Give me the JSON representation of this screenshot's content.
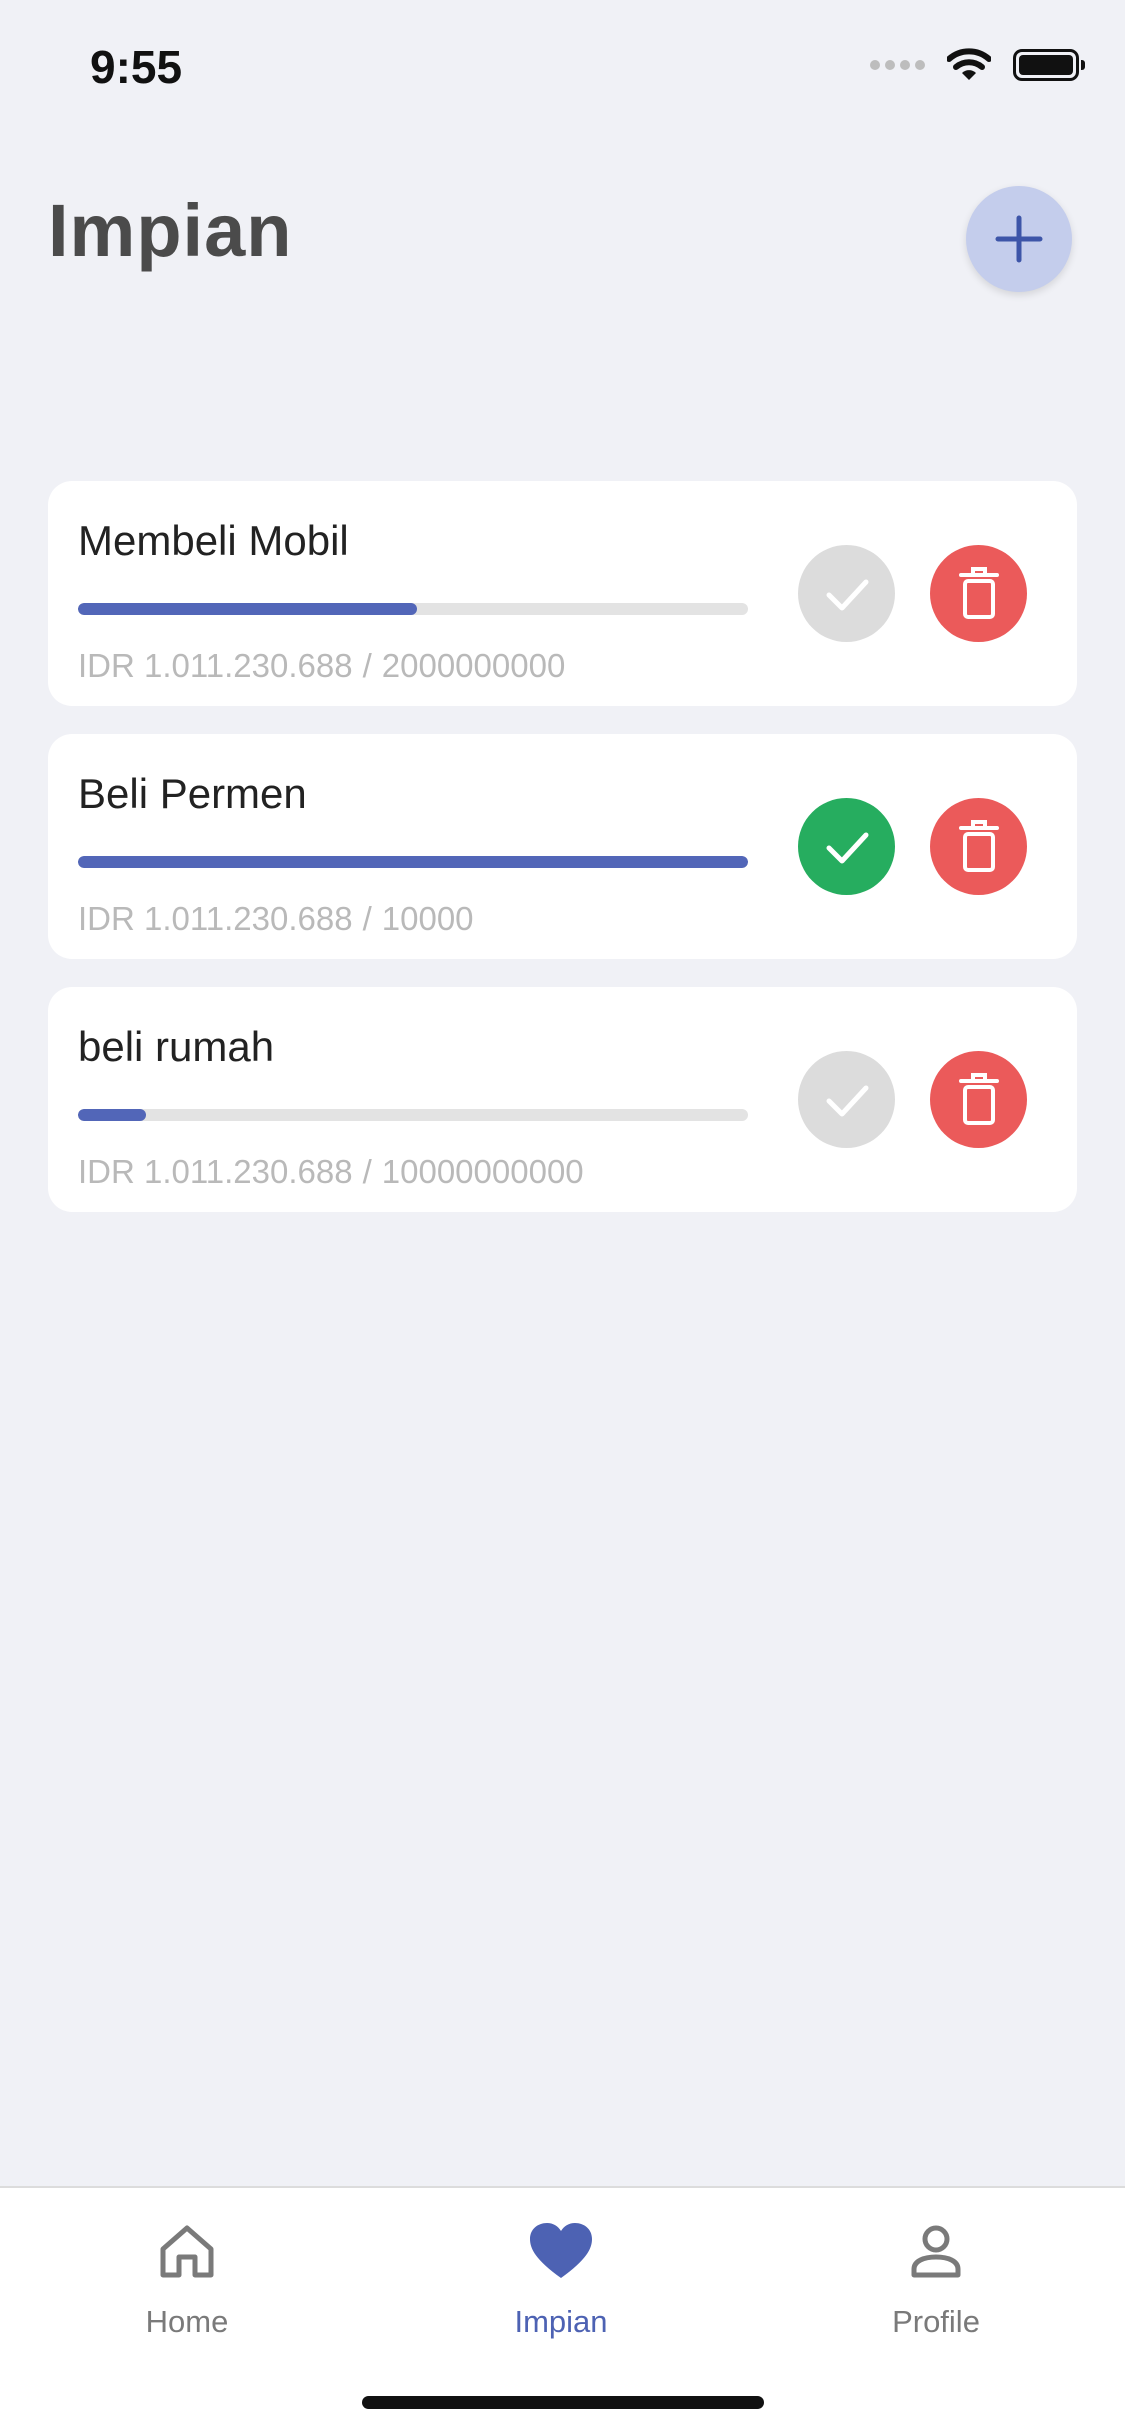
{
  "status_bar": {
    "time": "9:55"
  },
  "header": {
    "title": "Impian",
    "add_icon": "plus-icon"
  },
  "colors": {
    "accent": "#5266b8",
    "success": "#26ad5f",
    "danger": "#eb5a5a",
    "inactive": "#dcdcdc"
  },
  "dreams": [
    {
      "title": "Membeli Mobil",
      "saved": "IDR 1.011.230.688",
      "separator": "/",
      "target": "2000000000",
      "progress": 0.506,
      "completed": false
    },
    {
      "title": "Beli Permen",
      "saved": "IDR 1.011.230.688",
      "separator": "/",
      "target": "10000",
      "progress": 1.0,
      "completed": true
    },
    {
      "title": "beli rumah",
      "saved": "IDR 1.011.230.688",
      "separator": "/",
      "target": "10000000000",
      "progress": 0.101,
      "completed": false
    }
  ],
  "nav": {
    "items": [
      {
        "label": "Home",
        "icon": "home-icon",
        "active": false
      },
      {
        "label": "Impian",
        "icon": "heart-icon",
        "active": true
      },
      {
        "label": "Profile",
        "icon": "person-icon",
        "active": false
      }
    ]
  }
}
